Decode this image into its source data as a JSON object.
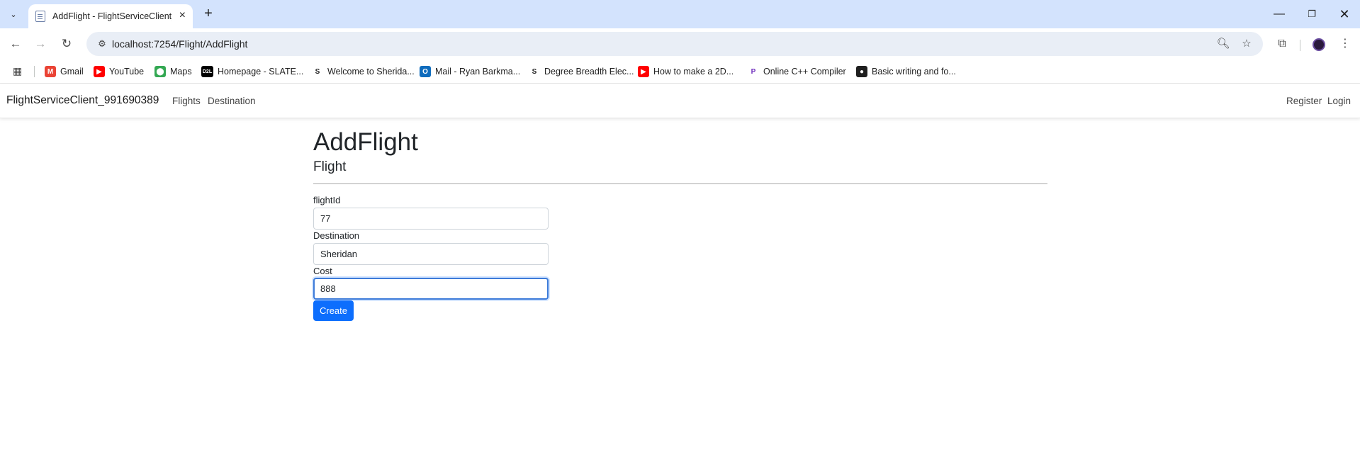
{
  "browser": {
    "tab": {
      "title": "AddFlight - FlightServiceClient_"
    },
    "url": "localhost:7254/Flight/AddFlight",
    "bookmarks": [
      {
        "label": "Gmail",
        "icon": "gmail-icon",
        "color": "#ea4335",
        "glyph": "M"
      },
      {
        "label": "YouTube",
        "icon": "youtube-icon",
        "color": "#ff0000",
        "glyph": "▶"
      },
      {
        "label": "Maps",
        "icon": "maps-icon",
        "color": "#34a853",
        "glyph": "⬤"
      },
      {
        "label": "Homepage - SLATE...",
        "icon": "d2l-icon",
        "color": "#000000",
        "glyph": "D2L"
      },
      {
        "label": "Welcome to Sherida...",
        "icon": "sheridan-icon",
        "color": "#ffffff",
        "glyph": "S"
      },
      {
        "label": "Mail - Ryan Barkma...",
        "icon": "outlook-icon",
        "color": "#0f6cbd",
        "glyph": "O"
      },
      {
        "label": "Degree Breadth Elec...",
        "icon": "sheridan-icon",
        "color": "#ffffff",
        "glyph": "S"
      },
      {
        "label": "How to make a 2D...",
        "icon": "youtube-icon",
        "color": "#ff0000",
        "glyph": "▶"
      },
      {
        "label": "Online C++ Compiler",
        "icon": "onlinegdb-icon",
        "color": "#ffffff",
        "glyph": "P"
      },
      {
        "label": "Basic writing and fo...",
        "icon": "github-icon",
        "color": "#1f1f1f",
        "glyph": "●"
      }
    ]
  },
  "site": {
    "brand": "FlightServiceClient_991690389",
    "nav_left": [
      "Flights",
      "Destination"
    ],
    "nav_right": [
      "Register",
      "Login"
    ]
  },
  "page": {
    "title": "AddFlight",
    "subtitle": "Flight",
    "fields": [
      {
        "label": "flightId",
        "value": "77"
      },
      {
        "label": "Destination",
        "value": "Sheridan"
      },
      {
        "label": "Cost",
        "value": "888"
      }
    ],
    "submit_label": "Create",
    "accent_color": "#0d6efd"
  }
}
